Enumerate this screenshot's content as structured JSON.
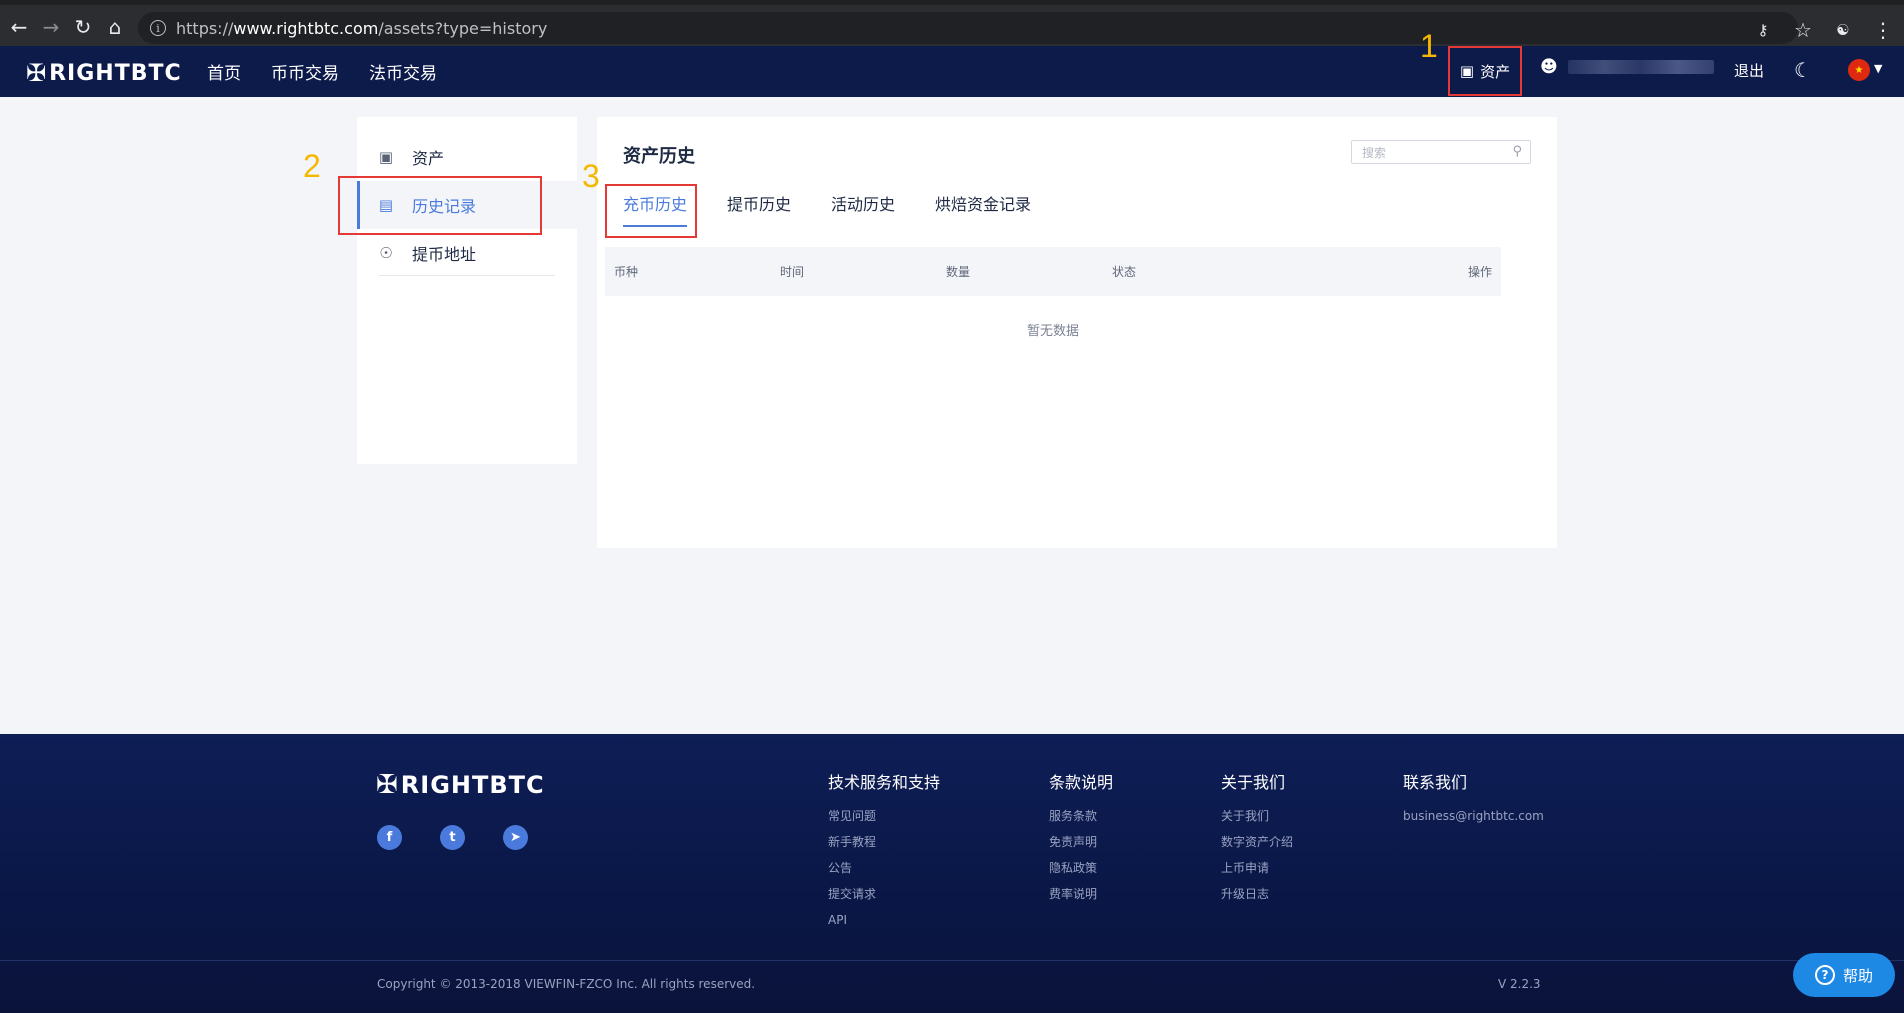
{
  "browser": {
    "url_scheme": "https://",
    "url_host": "www.rightbtc.com",
    "url_path": "/assets?type=history"
  },
  "header": {
    "logo": "RIGHTBTC",
    "nav": [
      "首页",
      "币币交易",
      "法币交易"
    ],
    "assets_label": "资产",
    "logout_label": "退出"
  },
  "annotations": {
    "a1": "1",
    "a2": "2",
    "a3": "3"
  },
  "sidebar": {
    "items": [
      {
        "label": "资产",
        "icon": "wallet-icon"
      },
      {
        "label": "历史记录",
        "icon": "document-icon",
        "active": true
      },
      {
        "label": "提币地址",
        "icon": "location-pin-icon"
      }
    ]
  },
  "main": {
    "title": "资产历史",
    "search_placeholder": "搜索",
    "tabs": [
      "充币历史",
      "提币历史",
      "活动历史",
      "烘焙资金记录"
    ],
    "active_tab": 0,
    "columns": [
      "币种",
      "时间",
      "数量",
      "状态",
      "操作"
    ],
    "empty_text": "暂无数据"
  },
  "footer": {
    "logo": "RIGHTBTC",
    "social": [
      "facebook-icon",
      "twitter-icon",
      "telegram-icon"
    ],
    "columns": [
      {
        "title": "技术服务和支持",
        "links": [
          "常见问题",
          "新手教程",
          "公告",
          "提交请求",
          "API"
        ]
      },
      {
        "title": "条款说明",
        "links": [
          "服务条款",
          "免责声明",
          "隐私政策",
          "费率说明"
        ]
      },
      {
        "title": "关于我们",
        "links": [
          "关于我们",
          "数字资产介绍",
          "上币申请",
          "升级日志"
        ]
      },
      {
        "title": "联系我们",
        "links": [
          "business@rightbtc.com"
        ]
      }
    ],
    "copyright": "Copyright © 2013-2018 VIEWFIN-FZCO Inc. All rights reserved.",
    "version": "V 2.2.3"
  },
  "help_label": "帮助",
  "colors": {
    "header_bg": "#0d1b4b",
    "accent": "#4a7bdc",
    "annotation_box": "#e53935",
    "annotation_num": "#f5b800"
  }
}
